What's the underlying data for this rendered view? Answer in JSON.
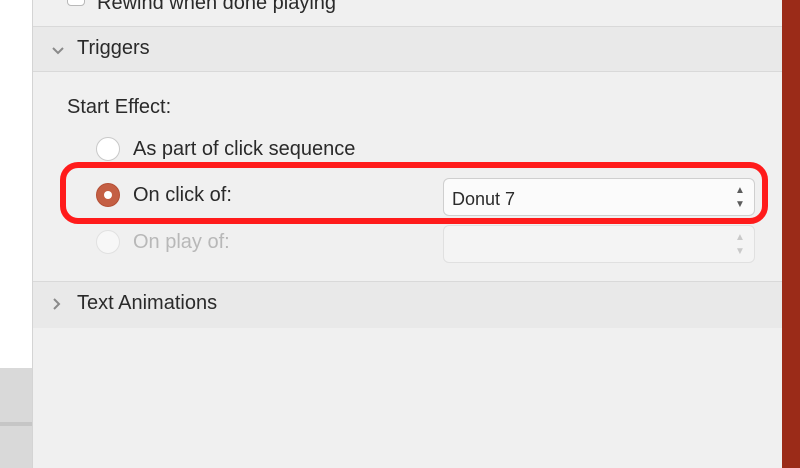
{
  "rewind": {
    "label": "Rewind when done playing"
  },
  "triggers": {
    "header": "Triggers",
    "start_effect_label": "Start Effect:",
    "options": [
      {
        "label": "As part of click sequence"
      },
      {
        "label": "On click of:",
        "selected_value": "Donut 7"
      },
      {
        "label": "On play of:",
        "selected_value": ""
      }
    ]
  },
  "text_animations": {
    "header": "Text Animations"
  },
  "colors": {
    "accent_radio": "#c45f44",
    "highlight": "#ff1b1b",
    "brand_strip": "#9b2b18"
  }
}
